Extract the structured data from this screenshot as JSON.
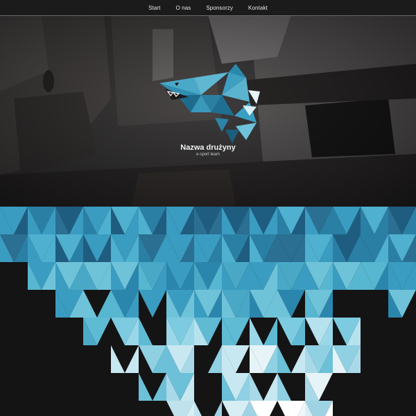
{
  "nav": {
    "items": [
      {
        "label": "Start"
      },
      {
        "label": "O nas"
      },
      {
        "label": "Sponsorzy"
      },
      {
        "label": "Kontakt"
      }
    ]
  },
  "hero": {
    "title": "Nazwa drużyny",
    "subtitle": "e-sport team",
    "logo_icon": "polygonal-shark-icon"
  },
  "colors": {
    "nav_bg": "#1b1b1b",
    "page_bg": "#141414",
    "pattern_dark": "#1f5d80",
    "pattern_mid": "#3a9cc0",
    "pattern_light": "#cfe9f2"
  }
}
